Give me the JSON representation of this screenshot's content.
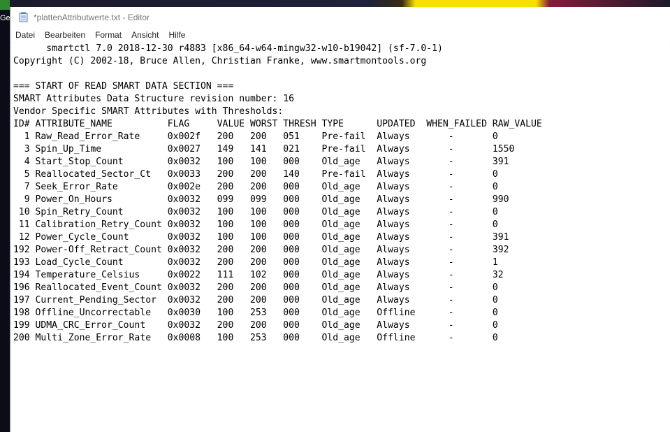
{
  "desktop": {
    "icon_label": "Ge"
  },
  "window": {
    "title": "*plattenAttributwerte.txt - Editor",
    "app_icon": "notepad-icon"
  },
  "menu": {
    "items": [
      "Datei",
      "Bearbeiten",
      "Format",
      "Ansicht",
      "Hilfe"
    ]
  },
  "editor": {
    "lines": [
      "      smartctl 7.0 2018-12-30 r4883 [x86_64-w64-mingw32-w10-b19042] (sf-7.0-1)",
      "Copyright (C) 2002-18, Bruce Allen, Christian Franke, www.smartmontools.org",
      "",
      "=== START OF READ SMART DATA SECTION ===",
      "SMART Attributes Data Structure revision number: 16",
      "Vendor Specific SMART Attributes with Thresholds:",
      "ID# ATTRIBUTE_NAME          FLAG     VALUE WORST THRESH TYPE      UPDATED  WHEN_FAILED RAW_VALUE",
      "  1 Raw_Read_Error_Rate     0x002f   200   200   051    Pre-fail  Always       -       0",
      "  3 Spin_Up_Time            0x0027   149   141   021    Pre-fail  Always       -       1550",
      "  4 Start_Stop_Count        0x0032   100   100   000    Old_age   Always       -       391",
      "  5 Reallocated_Sector_Ct   0x0033   200   200   140    Pre-fail  Always       -       0",
      "  7 Seek_Error_Rate         0x002e   200   200   000    Old_age   Always       -       0",
      "  9 Power_On_Hours          0x0032   099   099   000    Old_age   Always       -       990",
      " 10 Spin_Retry_Count        0x0032   100   100   000    Old_age   Always       -       0",
      " 11 Calibration_Retry_Count 0x0032   100   100   000    Old_age   Always       -       0",
      " 12 Power_Cycle_Count       0x0032   100   100   000    Old_age   Always       -       391",
      "192 Power-Off_Retract_Count 0x0032   200   200   000    Old_age   Always       -       392",
      "193 Load_Cycle_Count        0x0032   200   200   000    Old_age   Always       -       1",
      "194 Temperature_Celsius     0x0022   111   102   000    Old_age   Always       -       32",
      "196 Reallocated_Event_Count 0x0032   200   200   000    Old_age   Always       -       0",
      "197 Current_Pending_Sector  0x0032   200   200   000    Old_age   Always       -       0",
      "198 Offline_Uncorrectable   0x0030   100   253   000    Old_age   Offline      -       0",
      "199 UDMA_CRC_Error_Count    0x0032   200   200   000    Old_age   Always       -       0",
      "200 Multi_Zone_Error_Rate   0x0008   100   253   000    Old_age   Offline      -       0"
    ]
  }
}
